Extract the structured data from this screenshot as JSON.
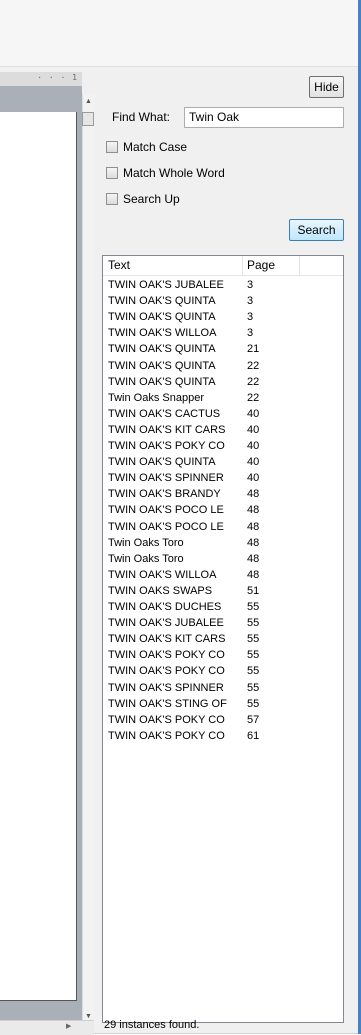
{
  "document": {
    "ruler_text": "· · · 1"
  },
  "panel": {
    "hide_label": "Hide",
    "find_what_label": "Find What:",
    "find_what_value": "Twin Oak",
    "match_case_label": "Match Case",
    "match_whole_word_label": "Match Whole Word",
    "search_up_label": "Search Up",
    "search_label": "Search"
  },
  "results": {
    "columns": [
      "Text",
      "Page"
    ],
    "rows": [
      {
        "text": "TWIN OAK'S JUBALEE",
        "page": "3"
      },
      {
        "text": "TWIN OAK'S QUINTA",
        "page": "3"
      },
      {
        "text": "TWIN OAK'S QUINTA",
        "page": "3"
      },
      {
        "text": "TWIN OAK'S WILLOA",
        "page": "3"
      },
      {
        "text": "TWIN OAK'S QUINTA",
        "page": "21"
      },
      {
        "text": "TWIN OAK'S QUINTA",
        "page": "22"
      },
      {
        "text": "TWIN OAK'S QUINTA",
        "page": "22"
      },
      {
        "text": "Twin Oaks Snapper",
        "page": "22"
      },
      {
        "text": "TWIN OAK'S CACTUS",
        "page": "40"
      },
      {
        "text": "TWIN OAK'S KIT CARS",
        "page": "40"
      },
      {
        "text": "TWIN OAK'S POKY CO",
        "page": "40"
      },
      {
        "text": "TWIN OAK'S QUINTA",
        "page": "40"
      },
      {
        "text": "TWIN OAK'S SPINNER",
        "page": "40"
      },
      {
        "text": "TWIN OAK'S BRANDY",
        "page": "48"
      },
      {
        "text": "TWIN OAK'S POCO LE",
        "page": "48"
      },
      {
        "text": "TWIN OAK'S POCO LE",
        "page": "48"
      },
      {
        "text": "Twin Oaks Toro",
        "page": "48"
      },
      {
        "text": "Twin Oaks Toro",
        "page": "48"
      },
      {
        "text": "TWIN OAK'S WILLOA",
        "page": "48"
      },
      {
        "text": "TWIN OAKS SWAPS",
        "page": "51"
      },
      {
        "text": "TWIN OAK'S DUCHES",
        "page": "55"
      },
      {
        "text": "TWIN OAK'S JUBALEE",
        "page": "55"
      },
      {
        "text": "TWIN OAK'S KIT CARS",
        "page": "55"
      },
      {
        "text": "TWIN OAK'S POKY CO",
        "page": "55"
      },
      {
        "text": "TWIN OAK'S POKY CO",
        "page": "55"
      },
      {
        "text": "TWIN OAK'S SPINNER",
        "page": "55"
      },
      {
        "text": "TWIN OAK'S STING OF",
        "page": "55"
      },
      {
        "text": "TWIN OAK'S POKY CO",
        "page": "57"
      },
      {
        "text": "TWIN OAK'S POKY CO",
        "page": "61"
      }
    ],
    "status": "29 instances found."
  }
}
